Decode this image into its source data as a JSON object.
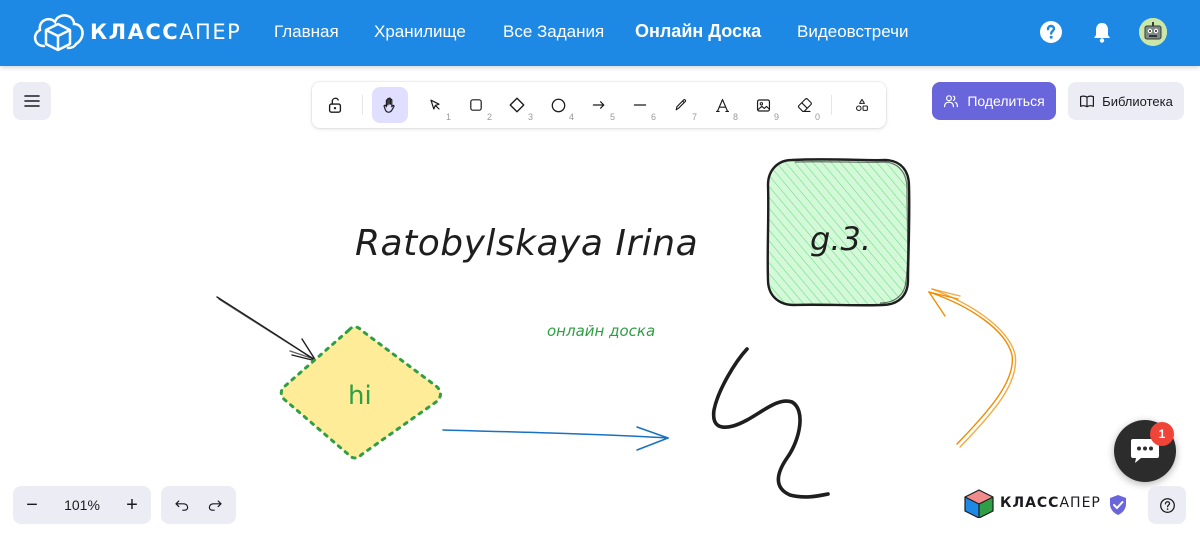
{
  "app": {
    "logo_text_bold": "КЛАСС",
    "logo_text_light": "АПЕР"
  },
  "nav": {
    "items": [
      {
        "label": "Главная"
      },
      {
        "label": "Хранилище"
      },
      {
        "label": "Все Задания"
      },
      {
        "label": "Онлайн Доска",
        "active": true
      },
      {
        "label": "Видеовстречи"
      }
    ],
    "icons": [
      "help-icon",
      "bell-icon",
      "avatar"
    ]
  },
  "toolbar": {
    "tools": [
      {
        "name": "lock",
        "icon": "lock-icon",
        "key": ""
      },
      {
        "name": "hand",
        "icon": "hand-icon",
        "key": "",
        "active": true
      },
      {
        "name": "selection",
        "icon": "cursor-icon",
        "key": "1"
      },
      {
        "name": "rectangle",
        "icon": "rectangle-icon",
        "key": "2"
      },
      {
        "name": "diamond",
        "icon": "diamond-icon",
        "key": "3"
      },
      {
        "name": "ellipse",
        "icon": "circle-icon",
        "key": "4"
      },
      {
        "name": "arrow",
        "icon": "arrow-icon",
        "key": "5"
      },
      {
        "name": "line",
        "icon": "line-icon",
        "key": "6"
      },
      {
        "name": "draw",
        "icon": "pencil-icon",
        "key": "7"
      },
      {
        "name": "text",
        "icon": "text-icon",
        "key": "8"
      },
      {
        "name": "image",
        "icon": "image-icon",
        "key": "9"
      },
      {
        "name": "eraser",
        "icon": "eraser-icon",
        "key": "0"
      },
      {
        "name": "shapes",
        "icon": "shapes-icon",
        "key": ""
      }
    ]
  },
  "actions": {
    "share_label": "Поделиться",
    "library_label": "Библиотека"
  },
  "canvas": {
    "title_text": "Ratobylskaya Irina",
    "box_text": "g.3.",
    "caption_text": "онлайн доска",
    "diamond_text": "hi"
  },
  "footer": {
    "zoom_value": "101%",
    "zoom_minus": "−",
    "zoom_plus": "+",
    "brand_bold": "КЛАСС",
    "brand_light": "АПЕР",
    "chat_badge": "1"
  },
  "colors": {
    "nav_bg": "#1e88e5",
    "accent": "#6965db",
    "diamond_fill": "#ffec99",
    "diamond_stroke": "#2f9e44",
    "box_fill": "#b2f2bb",
    "arrow_blue": "#1971c2",
    "arrow_orange": "#f08c00",
    "badge": "#f04438"
  }
}
